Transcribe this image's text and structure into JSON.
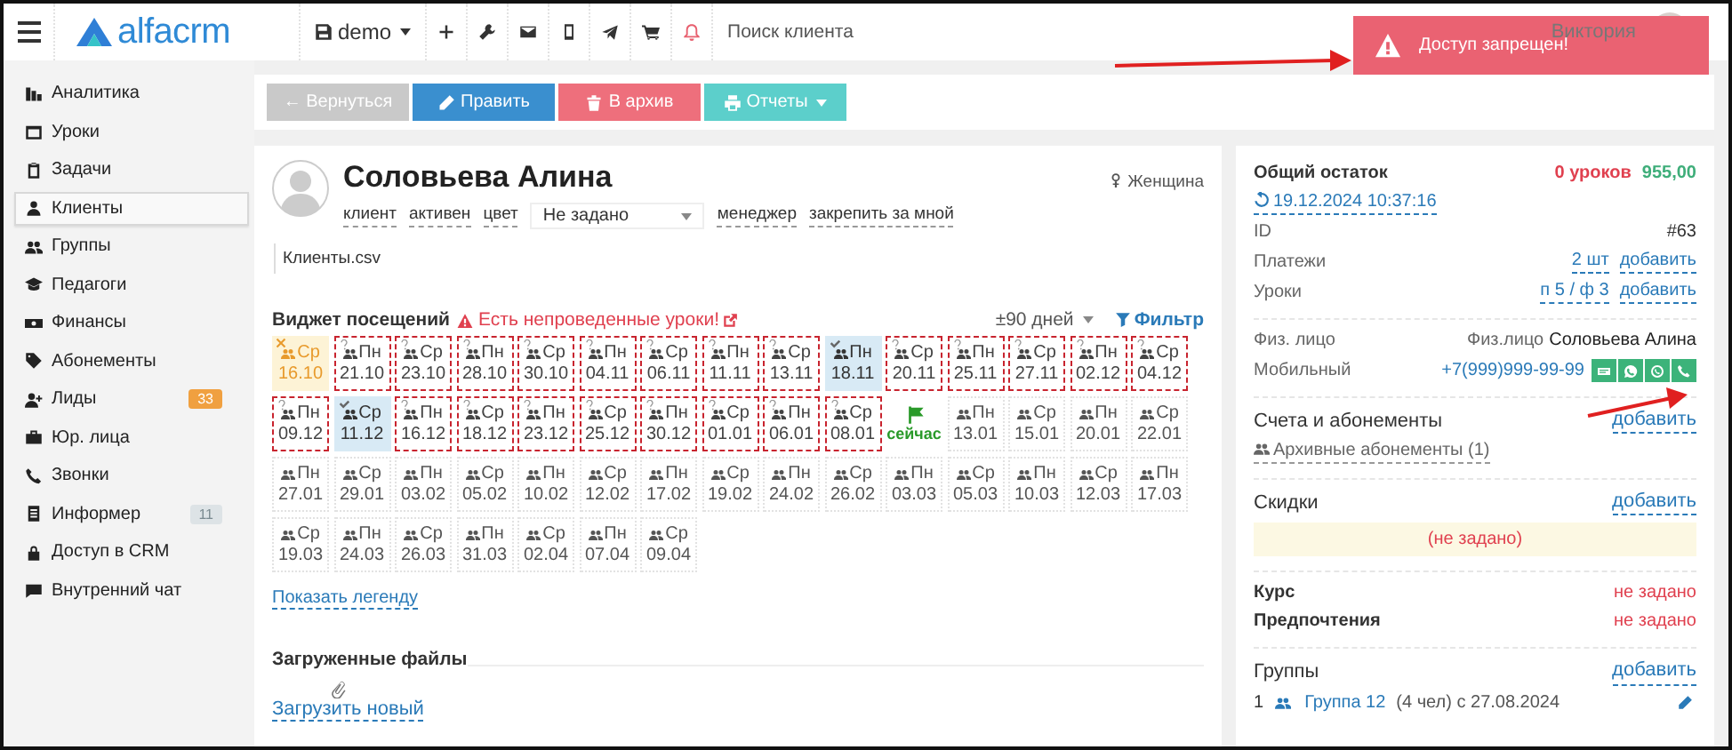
{
  "topbar": {
    "logo": "alfacrm",
    "branch": "demo",
    "search": {
      "placeholder": "Поиск клиента"
    },
    "user": "Виктория"
  },
  "toast": {
    "text": "Доступ запрещен!"
  },
  "sidebar": {
    "items": [
      {
        "label": "Аналитика",
        "selected": false
      },
      {
        "label": "Уроки",
        "selected": false
      },
      {
        "label": "Задачи",
        "selected": false
      },
      {
        "label": "Клиенты",
        "selected": true
      },
      {
        "label": "Группы",
        "selected": false
      },
      {
        "label": "Педагоги",
        "selected": false
      },
      {
        "label": "Финансы",
        "selected": false
      },
      {
        "label": "Абонементы",
        "selected": false
      },
      {
        "label": "Лиды",
        "selected": false,
        "badge": "33",
        "color": "#f0a040"
      },
      {
        "label": "Юр. лица",
        "selected": false
      },
      {
        "label": "Звонки",
        "selected": false
      },
      {
        "label": "Информер",
        "selected": false,
        "badge": "11",
        "color": "#dde3e6"
      },
      {
        "label": "Доступ в CRM",
        "selected": false
      },
      {
        "label": "Внутренний чат",
        "selected": false
      }
    ]
  },
  "toolbar": {
    "buttons": [
      {
        "kind": "back",
        "label": "← Вернуться"
      },
      {
        "kind": "edit",
        "label": "Править"
      },
      {
        "kind": "archive",
        "label": "В архив"
      },
      {
        "kind": "reports",
        "label": "Отчеты"
      }
    ]
  },
  "client": {
    "name": "Соловьева Алина",
    "gender": "Женщина",
    "tags": [
      "клиент",
      "активен",
      "цвет"
    ],
    "color_select": "Не задано",
    "manager": "менеджер",
    "assign": "закрепить за мной",
    "file": "Клиенты.csv"
  },
  "widget": {
    "title": "Виджет посещений",
    "warning": "Есть непроведенные уроки!",
    "range": "±90 дней",
    "filter": "Фильтр",
    "legend_link": "Показать легенду",
    "lessons": [
      {
        "kind": "cancelled",
        "day": "Ср",
        "date": "16.10"
      },
      {
        "kind": "unmarked",
        "day": "Пн",
        "date": "21.10"
      },
      {
        "kind": "unmarked",
        "day": "Ср",
        "date": "23.10"
      },
      {
        "kind": "unmarked",
        "day": "Пн",
        "date": "28.10"
      },
      {
        "kind": "unmarked",
        "day": "Ср",
        "date": "30.10"
      },
      {
        "kind": "unmarked",
        "day": "Пн",
        "date": "04.11"
      },
      {
        "kind": "unmarked",
        "day": "Ср",
        "date": "06.11"
      },
      {
        "kind": "unmarked",
        "day": "Пн",
        "date": "11.11"
      },
      {
        "kind": "unmarked",
        "day": "Ср",
        "date": "13.11"
      },
      {
        "kind": "attended",
        "day": "Пн",
        "date": "18.11"
      },
      {
        "kind": "unmarked",
        "day": "Ср",
        "date": "20.11"
      },
      {
        "kind": "unmarked",
        "day": "Пн",
        "date": "25.11"
      },
      {
        "kind": "unmarked",
        "day": "Ср",
        "date": "27.11"
      },
      {
        "kind": "unmarked",
        "day": "Пн",
        "date": "02.12"
      },
      {
        "kind": "unmarked",
        "day": "Ср",
        "date": "04.12"
      },
      {
        "kind": "unmarked",
        "day": "Пн",
        "date": "09.12"
      },
      {
        "kind": "attended",
        "day": "Ср",
        "date": "11.12"
      },
      {
        "kind": "unmarked",
        "day": "Пн",
        "date": "16.12"
      },
      {
        "kind": "unmarked",
        "day": "Ср",
        "date": "18.12"
      },
      {
        "kind": "unmarked",
        "day": "Пн",
        "date": "23.12"
      },
      {
        "kind": "unmarked",
        "day": "Ср",
        "date": "25.12"
      },
      {
        "kind": "unmarked",
        "day": "Пн",
        "date": "30.12"
      },
      {
        "kind": "unmarked",
        "day": "Ср",
        "date": "01.01"
      },
      {
        "kind": "unmarked",
        "day": "Пн",
        "date": "06.01"
      },
      {
        "kind": "unmarked",
        "day": "Ср",
        "date": "08.01"
      },
      {
        "kind": "now",
        "label": "сейчас"
      },
      {
        "kind": "future",
        "day": "Пн",
        "date": "13.01"
      },
      {
        "kind": "future",
        "day": "Ср",
        "date": "15.01"
      },
      {
        "kind": "future",
        "day": "Пн",
        "date": "20.01"
      },
      {
        "kind": "future",
        "day": "Ср",
        "date": "22.01"
      },
      {
        "kind": "future",
        "day": "Пн",
        "date": "27.01"
      },
      {
        "kind": "future",
        "day": "Ср",
        "date": "29.01"
      },
      {
        "kind": "future",
        "day": "Пн",
        "date": "03.02"
      },
      {
        "kind": "future",
        "day": "Ср",
        "date": "05.02"
      },
      {
        "kind": "future",
        "day": "Пн",
        "date": "10.02"
      },
      {
        "kind": "future",
        "day": "Ср",
        "date": "12.02"
      },
      {
        "kind": "future",
        "day": "Пн",
        "date": "17.02"
      },
      {
        "kind": "future",
        "day": "Ср",
        "date": "19.02"
      },
      {
        "kind": "future",
        "day": "Пн",
        "date": "24.02"
      },
      {
        "kind": "future",
        "day": "Ср",
        "date": "26.02"
      },
      {
        "kind": "future",
        "day": "Пн",
        "date": "03.03"
      },
      {
        "kind": "future",
        "day": "Ср",
        "date": "05.03"
      },
      {
        "kind": "future",
        "day": "Пн",
        "date": "10.03"
      },
      {
        "kind": "future",
        "day": "Ср",
        "date": "12.03"
      },
      {
        "kind": "future",
        "day": "Пн",
        "date": "17.03"
      },
      {
        "kind": "future",
        "day": "Ср",
        "date": "19.03"
      },
      {
        "kind": "future",
        "day": "Пн",
        "date": "24.03"
      },
      {
        "kind": "future",
        "day": "Ср",
        "date": "26.03"
      },
      {
        "kind": "future",
        "day": "Пн",
        "date": "31.03"
      },
      {
        "kind": "future",
        "day": "Ср",
        "date": "02.04"
      },
      {
        "kind": "future",
        "day": "Пн",
        "date": "07.04"
      },
      {
        "kind": "future",
        "day": "Ср",
        "date": "09.04"
      }
    ]
  },
  "files": {
    "title": "Загруженные файлы",
    "upload": "Загрузить новый"
  },
  "summary": {
    "title": "Общий остаток",
    "lessons": "0 уроков",
    "amount": "955,00",
    "updated": "19.12.2024 10:37:16",
    "rows": [
      {
        "label": "ID",
        "value": "#63"
      },
      {
        "label": "Платежи",
        "value": "2 шт",
        "action": "добавить"
      },
      {
        "label": "Уроки",
        "value": "п 5 / ф 3",
        "action": "добавить"
      }
    ],
    "person": {
      "label": "Физ. лицо",
      "prefix": "Физ.лицо",
      "name": "Соловьева Алина"
    },
    "mobile": {
      "label": "Мобильный",
      "phone": "+7(999)999-99-99",
      "actions": [
        {
          "kind": "sms"
        },
        {
          "kind": "whatsapp"
        },
        {
          "kind": "viber"
        },
        {
          "kind": "call"
        }
      ]
    }
  },
  "subscriptions": {
    "title": "Счета и абонементы",
    "action": "добавить",
    "archive": "Архивные абонементы (1)"
  },
  "discounts": {
    "title": "Скидки",
    "action": "добавить",
    "empty": "(не задано)"
  },
  "details": [
    {
      "label": "Курс",
      "value": "не задано"
    },
    {
      "label": "Предпочтения",
      "value": "не задано"
    }
  ],
  "groups": {
    "title": "Группы",
    "action": "добавить",
    "items": [
      {
        "number": "1",
        "name": "Группа 12",
        "info": "(4 чел) с 27.08.2024"
      }
    ]
  }
}
